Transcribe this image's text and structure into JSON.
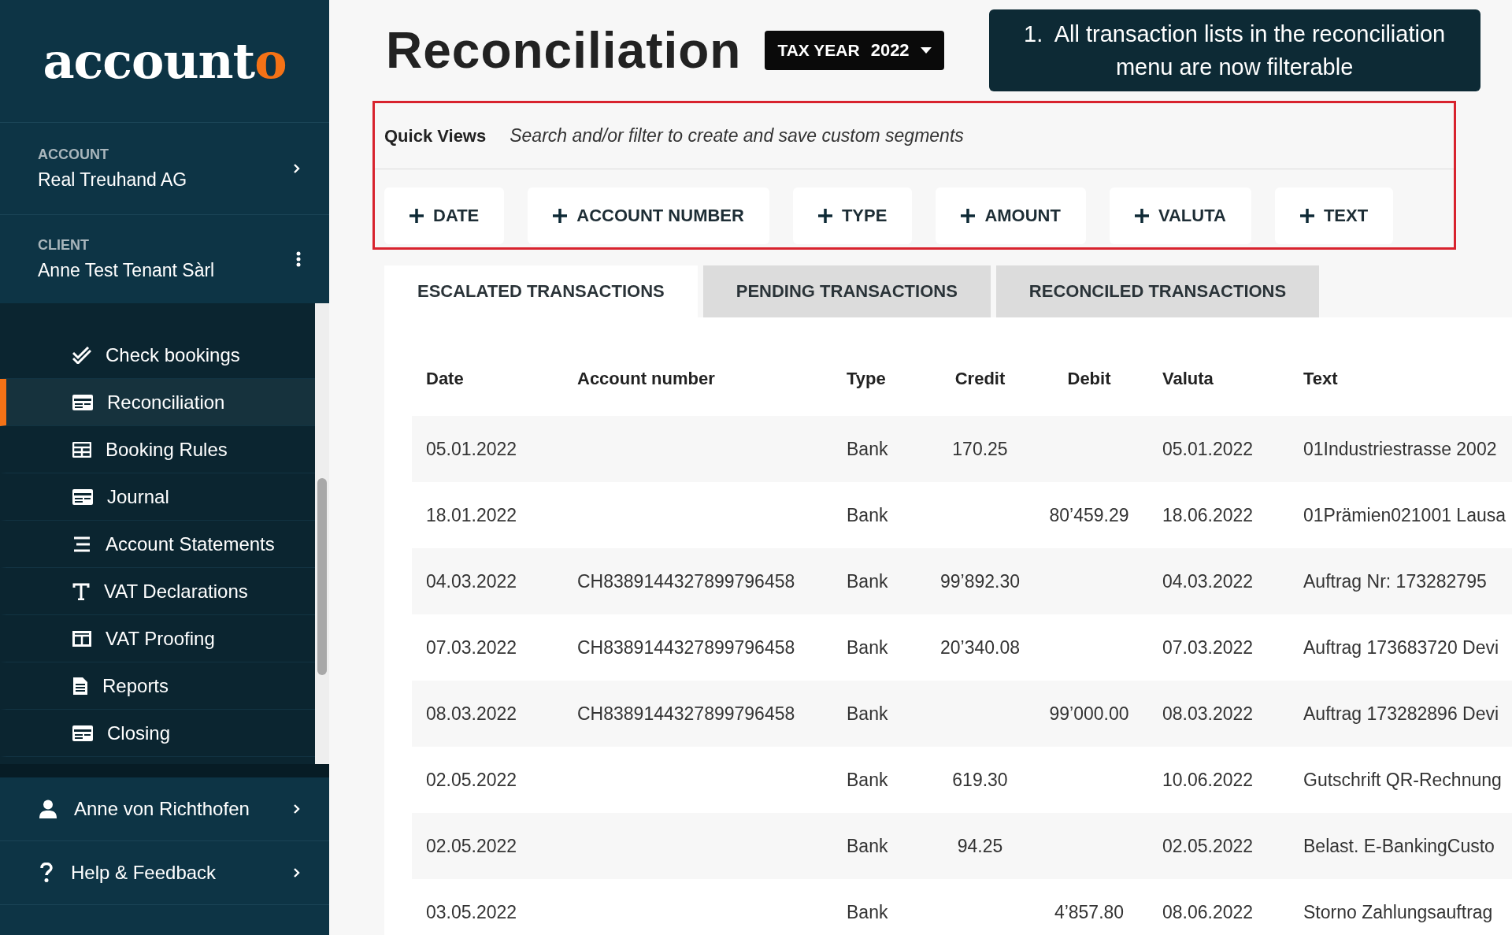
{
  "logo": {
    "main": "account",
    "accent": "o"
  },
  "account": {
    "label": "ACCOUNT",
    "value": "Real Treuhand AG"
  },
  "client": {
    "label": "CLIENT",
    "value": "Anne Test Tenant Sàrl"
  },
  "nav": [
    {
      "label": "Check bookings",
      "kind": "check",
      "selected": false
    },
    {
      "label": "Reconciliation",
      "kind": "card",
      "selected": true
    },
    {
      "label": "Booking Rules",
      "kind": "grid",
      "selected": false
    },
    {
      "label": "Journal",
      "kind": "card",
      "selected": false
    },
    {
      "label": "Account Statements",
      "kind": "lines",
      "selected": false
    },
    {
      "label": "VAT Declarations",
      "kind": "letter",
      "selected": false
    },
    {
      "label": "VAT Proofing",
      "kind": "columns",
      "selected": false
    },
    {
      "label": "Reports",
      "kind": "document",
      "selected": false
    },
    {
      "label": "Closing",
      "kind": "card",
      "selected": false
    }
  ],
  "footer": [
    {
      "label": "Anne von Richthofen",
      "kind": "person"
    },
    {
      "label": "Help & Feedback",
      "kind": "question"
    }
  ],
  "title": "Reconciliation",
  "tax_year": {
    "label": "TAX YEAR",
    "value": "2022"
  },
  "callout": {
    "number": "1.",
    "text": "All transaction lists in the reconciliation menu are now filterable"
  },
  "quick_views": {
    "label": "Quick Views",
    "hint": "Search and/or filter to create and save custom segments"
  },
  "filters": [
    {
      "label": "DATE"
    },
    {
      "label": "ACCOUNT NUMBER"
    },
    {
      "label": "TYPE"
    },
    {
      "label": "AMOUNT"
    },
    {
      "label": "VALUTA"
    },
    {
      "label": "TEXT"
    }
  ],
  "tabs": [
    {
      "label": "ESCALATED TRANSACTIONS",
      "selected": true
    },
    {
      "label": "PENDING TRANSACTIONS",
      "selected": false
    },
    {
      "label": "RECONCILED TRANSACTIONS",
      "selected": false
    }
  ],
  "table": {
    "columns": [
      "Date",
      "Account number",
      "Type",
      "Credit",
      "Debit",
      "Valuta",
      "Text"
    ],
    "rows": [
      {
        "date": "05.01.2022",
        "type": "Bank",
        "credit": "170.25",
        "valuta": "05.01.2022",
        "text": "01Industriestrasse 2002"
      },
      {
        "date": "18.01.2022",
        "type": "Bank",
        "debit": "80’459.29",
        "valuta": "18.06.2022",
        "text": "01Prämien021001 Lausa"
      },
      {
        "date": "04.03.2022",
        "account_number": "CH8389144327899796458",
        "type": "Bank",
        "credit": "99’892.30",
        "valuta": "04.03.2022",
        "text": "Auftrag Nr: 173282795"
      },
      {
        "date": "07.03.2022",
        "account_number": "CH8389144327899796458",
        "type": "Bank",
        "credit": "20’340.08",
        "valuta": "07.03.2022",
        "text": "Auftrag 173683720 Devi"
      },
      {
        "date": "08.03.2022",
        "account_number": "CH8389144327899796458",
        "type": "Bank",
        "debit": "99’000.00",
        "valuta": "08.03.2022",
        "text": "Auftrag 173282896 Devi"
      },
      {
        "date": "02.05.2022",
        "type": "Bank",
        "credit": "619.30",
        "valuta": "10.06.2022",
        "text": "Gutschrift QR-Rechnung"
      },
      {
        "date": "02.05.2022",
        "type": "Bank",
        "credit": "94.25",
        "valuta": "02.05.2022",
        "text": "Belast. E-BankingCusto"
      },
      {
        "date": "03.05.2022",
        "type": "Bank",
        "debit": "4’857.80",
        "valuta": "08.06.2022",
        "text": "Storno Zahlungsauftrag"
      }
    ]
  }
}
